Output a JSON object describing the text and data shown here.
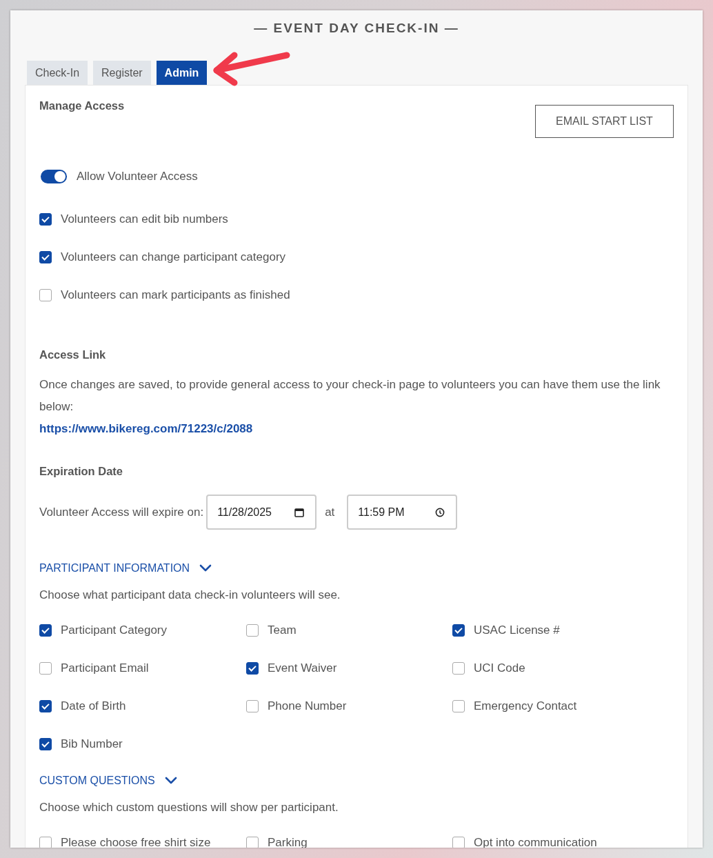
{
  "title": "— EVENT DAY CHECK-IN —",
  "tabs": [
    {
      "label": "Check-In",
      "selected": false
    },
    {
      "label": "Register",
      "selected": false
    },
    {
      "label": "Admin",
      "selected": true
    }
  ],
  "manage_access": {
    "heading": "Manage Access",
    "email_button": "EMAIL START LIST",
    "toggle": {
      "label": "Allow Volunteer Access",
      "on": true
    },
    "options": [
      {
        "label": "Volunteers can edit bib numbers",
        "checked": true
      },
      {
        "label": "Volunteers can change participant category",
        "checked": true
      },
      {
        "label": "Volunteers can mark participants as finished",
        "checked": false
      }
    ]
  },
  "access_link": {
    "heading": "Access Link",
    "text": "Once changes are saved, to provide general access to your check-in page to volunteers you can have them use the link below:",
    "link": "https://www.bikereg.com/71223/c/2088"
  },
  "expiration": {
    "heading": "Expiration Date",
    "label": "Volunteer Access will expire on:",
    "date": "11/28/2025",
    "at": "at",
    "time": "11:59 PM"
  },
  "participant_information": {
    "heading": "PARTICIPANT INFORMATION",
    "description": "Choose what participant data check-in volunteers will see.",
    "fields": [
      {
        "label": "Participant Category",
        "checked": true
      },
      {
        "label": "Team",
        "checked": false
      },
      {
        "label": "USAC License #",
        "checked": true
      },
      {
        "label": "Participant Email",
        "checked": false
      },
      {
        "label": "Event Waiver",
        "checked": true
      },
      {
        "label": "UCI Code",
        "checked": false
      },
      {
        "label": "Date of Birth",
        "checked": true
      },
      {
        "label": "Phone Number",
        "checked": false
      },
      {
        "label": "Emergency Contact",
        "checked": false
      },
      {
        "label": "Bib Number",
        "checked": true
      }
    ]
  },
  "custom_questions": {
    "heading": "CUSTOM QUESTIONS",
    "description": "Choose which custom questions will show per participant.",
    "fields": [
      {
        "label": "Please choose free shirt size",
        "checked": false
      },
      {
        "label": "Parking",
        "checked": false
      },
      {
        "label": "Opt into communication",
        "checked": false
      }
    ]
  }
}
